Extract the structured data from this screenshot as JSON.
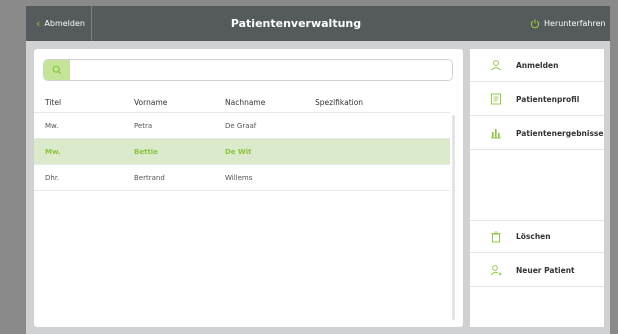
{
  "header": {
    "back_label": "Abmelden",
    "title": "Patientenverwaltung",
    "shutdown_label": "Herunterfahren"
  },
  "search": {
    "value": "",
    "placeholder": ""
  },
  "table": {
    "columns": [
      "Titel",
      "Vorname",
      "Nachname",
      "Spezifikation"
    ],
    "rows": [
      [
        "Mw.",
        "Petra",
        "De Graaf",
        ""
      ],
      [
        "Mw.",
        "Bettie",
        "De Wit",
        ""
      ],
      [
        "Dhr.",
        "Bertrand",
        "Willems",
        ""
      ]
    ],
    "selected_row": 1
  },
  "sidebar": {
    "items": [
      {
        "label": "Anmelden",
        "icon": "user-icon"
      },
      {
        "label": "Patientenprofil",
        "icon": "profile-icon"
      },
      {
        "label": "Patientenergebnisse",
        "icon": "bar-chart-icon"
      },
      {
        "label": "Löschen",
        "icon": "trash-icon"
      },
      {
        "label": "Neuer Patient",
        "icon": "add-user-icon"
      }
    ]
  },
  "colors": {
    "accent": "#8cc33f",
    "header_bg": "#555a5c",
    "selected_row_bg": "#dbeacb"
  }
}
